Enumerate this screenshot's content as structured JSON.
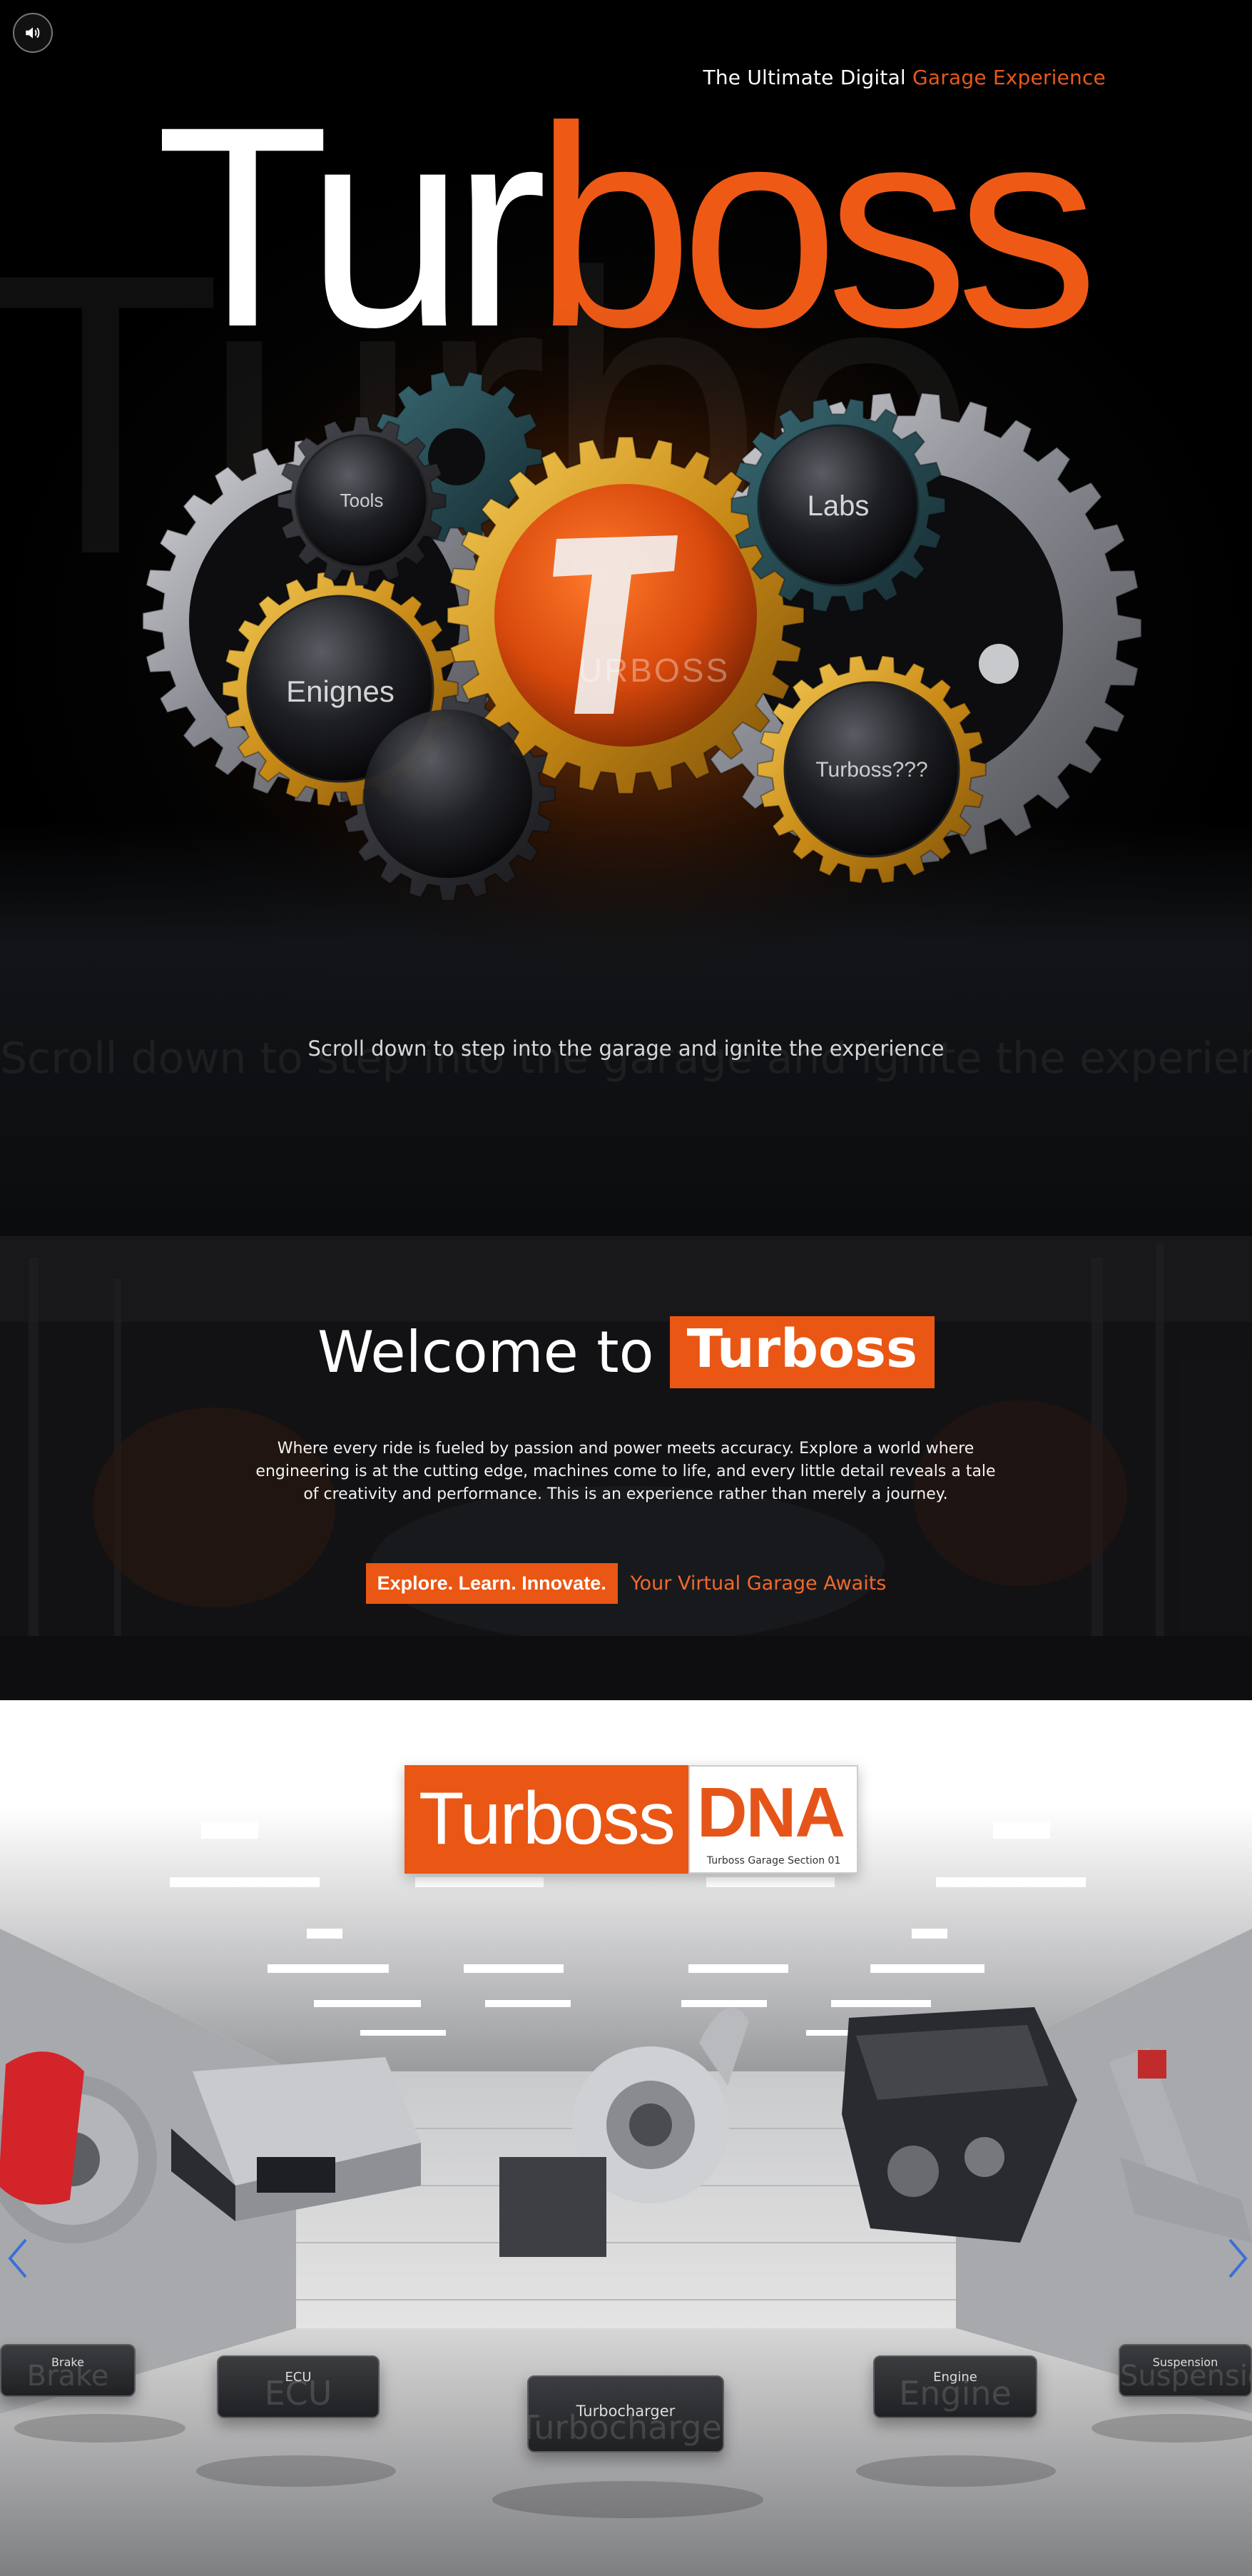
{
  "hero": {
    "sound_button_label": "Toggle sound",
    "tagline_prefix": "The Ultimate Digital",
    "tagline_accent": "Garage Experience",
    "logo_white": "Tur",
    "logo_orange": "boss",
    "ghost_word": "Turbo",
    "center_gear_text": "URBOSS",
    "gears": [
      {
        "label": "Tools"
      },
      {
        "label": "Labs"
      },
      {
        "label": "Enignes"
      },
      {
        "label": "Turboss???"
      }
    ],
    "scroll_hint": "Scroll down to step into the garage and ignite the experience"
  },
  "welcome": {
    "title_prefix": "Welcome to",
    "title_highlight": "Turboss",
    "body": "Where every ride is fueled by passion and power meets accuracy. Explore a world where engineering is at the cutting edge, machines come to life, and every little detail reveals a tale of creativity and performance. This is an experience rather than merely a journey.",
    "button_label": "Explore. Learn. Innovate.",
    "link_label": "Your Virtual Garage Awaits"
  },
  "dna": {
    "badge_left": "Turboss",
    "badge_right": "DNA",
    "badge_sub": "Turboss Garage Section 01",
    "parts": [
      {
        "label": "Brake",
        "ghost": "Brake"
      },
      {
        "label": "ECU",
        "ghost": "ECU"
      },
      {
        "label": "Turbocharger",
        "ghost": "Turbocharger"
      },
      {
        "label": "Engine",
        "ghost": "Engine"
      },
      {
        "label": "Suspension",
        "ghost": "Suspension"
      }
    ]
  },
  "colors": {
    "brand_orange": "#ea5614",
    "gold": "#d49a1e",
    "steel": "#9a9ca3",
    "teal": "#1f3c42"
  }
}
